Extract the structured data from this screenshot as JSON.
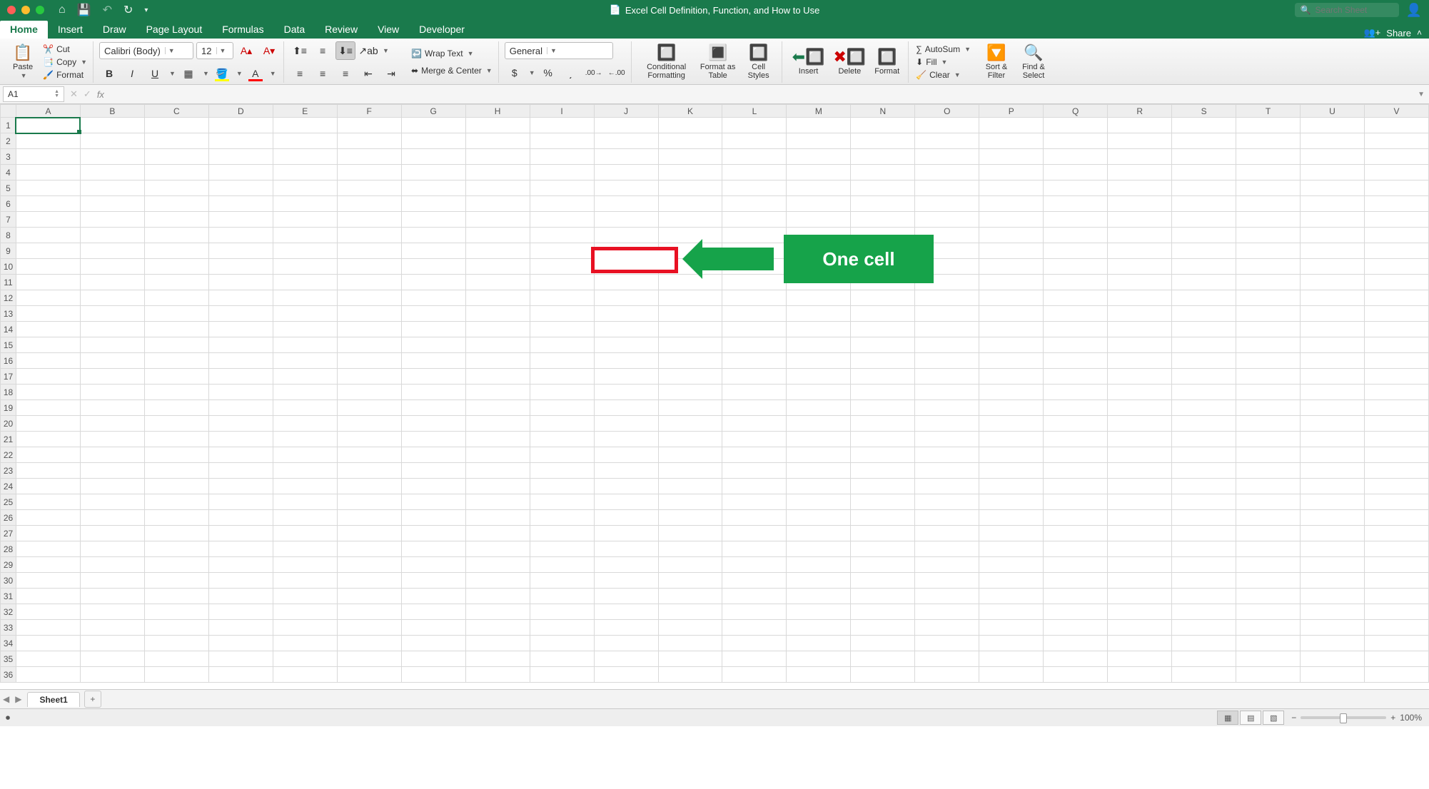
{
  "titlebar": {
    "document_title": "Excel Cell Definition, Function, and How to Use",
    "search_placeholder": "Search Sheet"
  },
  "tabs": {
    "items": [
      "Home",
      "Insert",
      "Draw",
      "Page Layout",
      "Formulas",
      "Data",
      "Review",
      "View",
      "Developer"
    ],
    "active_index": 0,
    "share_label": "Share"
  },
  "ribbon": {
    "clipboard": {
      "paste": "Paste",
      "cut": "Cut",
      "copy": "Copy",
      "format": "Format"
    },
    "font": {
      "name": "Calibri (Body)",
      "size": "12"
    },
    "alignment": {
      "wrap": "Wrap Text",
      "merge": "Merge & Center"
    },
    "number": {
      "format": "General"
    },
    "styles": {
      "cond": "Conditional Formatting",
      "table": "Format as Table",
      "cell": "Cell Styles"
    },
    "cells": {
      "insert": "Insert",
      "delete": "Delete",
      "format": "Format"
    },
    "editing": {
      "autosum": "AutoSum",
      "fill": "Fill",
      "clear": "Clear",
      "sort": "Sort & Filter",
      "find": "Find & Select"
    }
  },
  "formula_bar": {
    "name_box": "A1",
    "fx_label": "fx",
    "formula": ""
  },
  "grid": {
    "columns": [
      "A",
      "B",
      "C",
      "D",
      "E",
      "F",
      "G",
      "H",
      "I",
      "J",
      "K",
      "L",
      "M",
      "N",
      "O",
      "P",
      "Q",
      "R",
      "S",
      "T",
      "U",
      "V"
    ],
    "row_count": 36,
    "selected_cell": "A1"
  },
  "annotation": {
    "callout_text": "One cell"
  },
  "sheet_tabs": {
    "active": "Sheet1"
  },
  "status": {
    "zoom": "100%"
  }
}
